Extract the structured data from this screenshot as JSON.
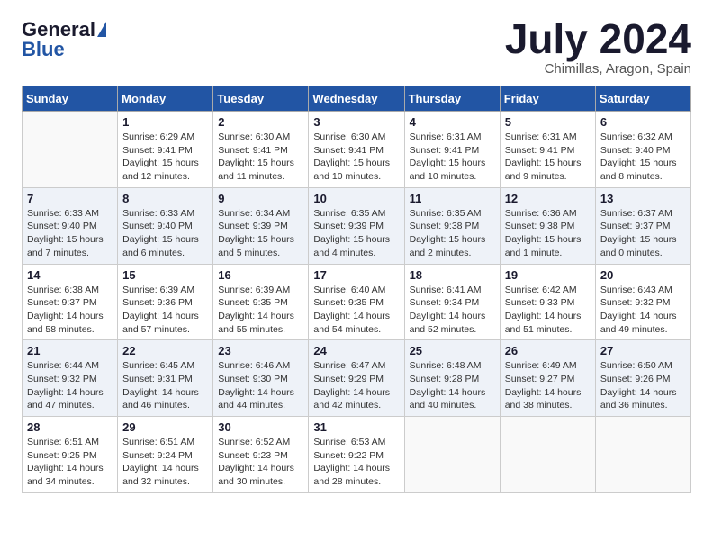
{
  "logo": {
    "general": "General",
    "blue": "Blue"
  },
  "header": {
    "month": "July 2024",
    "location": "Chimillas, Aragon, Spain"
  },
  "weekdays": [
    "Sunday",
    "Monday",
    "Tuesday",
    "Wednesday",
    "Thursday",
    "Friday",
    "Saturday"
  ],
  "weeks": [
    [
      {
        "day": "",
        "info": ""
      },
      {
        "day": "1",
        "info": "Sunrise: 6:29 AM\nSunset: 9:41 PM\nDaylight: 15 hours\nand 12 minutes."
      },
      {
        "day": "2",
        "info": "Sunrise: 6:30 AM\nSunset: 9:41 PM\nDaylight: 15 hours\nand 11 minutes."
      },
      {
        "day": "3",
        "info": "Sunrise: 6:30 AM\nSunset: 9:41 PM\nDaylight: 15 hours\nand 10 minutes."
      },
      {
        "day": "4",
        "info": "Sunrise: 6:31 AM\nSunset: 9:41 PM\nDaylight: 15 hours\nand 10 minutes."
      },
      {
        "day": "5",
        "info": "Sunrise: 6:31 AM\nSunset: 9:41 PM\nDaylight: 15 hours\nand 9 minutes."
      },
      {
        "day": "6",
        "info": "Sunrise: 6:32 AM\nSunset: 9:40 PM\nDaylight: 15 hours\nand 8 minutes."
      }
    ],
    [
      {
        "day": "7",
        "info": "Sunrise: 6:33 AM\nSunset: 9:40 PM\nDaylight: 15 hours\nand 7 minutes."
      },
      {
        "day": "8",
        "info": "Sunrise: 6:33 AM\nSunset: 9:40 PM\nDaylight: 15 hours\nand 6 minutes."
      },
      {
        "day": "9",
        "info": "Sunrise: 6:34 AM\nSunset: 9:39 PM\nDaylight: 15 hours\nand 5 minutes."
      },
      {
        "day": "10",
        "info": "Sunrise: 6:35 AM\nSunset: 9:39 PM\nDaylight: 15 hours\nand 4 minutes."
      },
      {
        "day": "11",
        "info": "Sunrise: 6:35 AM\nSunset: 9:38 PM\nDaylight: 15 hours\nand 2 minutes."
      },
      {
        "day": "12",
        "info": "Sunrise: 6:36 AM\nSunset: 9:38 PM\nDaylight: 15 hours\nand 1 minute."
      },
      {
        "day": "13",
        "info": "Sunrise: 6:37 AM\nSunset: 9:37 PM\nDaylight: 15 hours\nand 0 minutes."
      }
    ],
    [
      {
        "day": "14",
        "info": "Sunrise: 6:38 AM\nSunset: 9:37 PM\nDaylight: 14 hours\nand 58 minutes."
      },
      {
        "day": "15",
        "info": "Sunrise: 6:39 AM\nSunset: 9:36 PM\nDaylight: 14 hours\nand 57 minutes."
      },
      {
        "day": "16",
        "info": "Sunrise: 6:39 AM\nSunset: 9:35 PM\nDaylight: 14 hours\nand 55 minutes."
      },
      {
        "day": "17",
        "info": "Sunrise: 6:40 AM\nSunset: 9:35 PM\nDaylight: 14 hours\nand 54 minutes."
      },
      {
        "day": "18",
        "info": "Sunrise: 6:41 AM\nSunset: 9:34 PM\nDaylight: 14 hours\nand 52 minutes."
      },
      {
        "day": "19",
        "info": "Sunrise: 6:42 AM\nSunset: 9:33 PM\nDaylight: 14 hours\nand 51 minutes."
      },
      {
        "day": "20",
        "info": "Sunrise: 6:43 AM\nSunset: 9:32 PM\nDaylight: 14 hours\nand 49 minutes."
      }
    ],
    [
      {
        "day": "21",
        "info": "Sunrise: 6:44 AM\nSunset: 9:32 PM\nDaylight: 14 hours\nand 47 minutes."
      },
      {
        "day": "22",
        "info": "Sunrise: 6:45 AM\nSunset: 9:31 PM\nDaylight: 14 hours\nand 46 minutes."
      },
      {
        "day": "23",
        "info": "Sunrise: 6:46 AM\nSunset: 9:30 PM\nDaylight: 14 hours\nand 44 minutes."
      },
      {
        "day": "24",
        "info": "Sunrise: 6:47 AM\nSunset: 9:29 PM\nDaylight: 14 hours\nand 42 minutes."
      },
      {
        "day": "25",
        "info": "Sunrise: 6:48 AM\nSunset: 9:28 PM\nDaylight: 14 hours\nand 40 minutes."
      },
      {
        "day": "26",
        "info": "Sunrise: 6:49 AM\nSunset: 9:27 PM\nDaylight: 14 hours\nand 38 minutes."
      },
      {
        "day": "27",
        "info": "Sunrise: 6:50 AM\nSunset: 9:26 PM\nDaylight: 14 hours\nand 36 minutes."
      }
    ],
    [
      {
        "day": "28",
        "info": "Sunrise: 6:51 AM\nSunset: 9:25 PM\nDaylight: 14 hours\nand 34 minutes."
      },
      {
        "day": "29",
        "info": "Sunrise: 6:51 AM\nSunset: 9:24 PM\nDaylight: 14 hours\nand 32 minutes."
      },
      {
        "day": "30",
        "info": "Sunrise: 6:52 AM\nSunset: 9:23 PM\nDaylight: 14 hours\nand 30 minutes."
      },
      {
        "day": "31",
        "info": "Sunrise: 6:53 AM\nSunset: 9:22 PM\nDaylight: 14 hours\nand 28 minutes."
      },
      {
        "day": "",
        "info": ""
      },
      {
        "day": "",
        "info": ""
      },
      {
        "day": "",
        "info": ""
      }
    ]
  ]
}
